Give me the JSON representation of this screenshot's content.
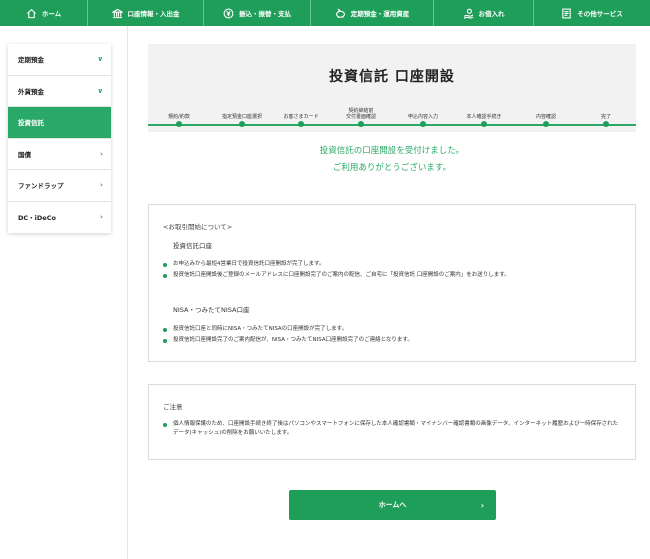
{
  "topnav": [
    {
      "label": "ホーム",
      "icon": "home-icon"
    },
    {
      "label": "口座情報・入出金",
      "icon": "bank-icon"
    },
    {
      "label": "振込・振替・支払",
      "icon": "yen-coin-icon"
    },
    {
      "label": "定期預金・運用資産",
      "icon": "piggy-bank-icon"
    },
    {
      "label": "お借入れ",
      "icon": "hand-coin-icon"
    },
    {
      "label": "その他サービス",
      "icon": "document-list-icon"
    }
  ],
  "sidebar": {
    "items": [
      {
        "label": "定期預金",
        "chevron": "∨"
      },
      {
        "label": "外貨預金",
        "chevron": "∨"
      },
      {
        "label": "投資信託",
        "chevron": ""
      },
      {
        "label": "国債",
        "chevron": "›"
      },
      {
        "label": "ファンドラップ",
        "chevron": "›"
      },
      {
        "label": "DC・iDeCo",
        "chevron": "›"
      }
    ]
  },
  "header": {
    "title": "投資信託 口座開設",
    "steps": [
      "規約/約款",
      "指定預金口座選択",
      "お客さまカード",
      "契約締結前\n交付書面確認",
      "申込内容入力",
      "本人確認手続き",
      "内容確認",
      "完了"
    ]
  },
  "complete": {
    "line1": "投資信託の口座開設を受付けました。",
    "line2": "ご利用ありがとうございます。"
  },
  "info": {
    "heading": "<お取引開始について>",
    "section1_title": "投資信託口座",
    "section1_bullets": [
      "お申込みから最短4営業日で投資信託口座開設が完了します。",
      "投資信託口座開設後ご登録のメールアドレスに口座開設完了のご案内の配信、ご自宅に「投資信託 口座開設のご案内」をお送りします。"
    ],
    "section2_title": "NISA・つみたてNISA口座",
    "section2_bullets": [
      "投資信託口座と同時にNISA・つみたてNISAの口座開設が完了します。",
      "投資信託口座開設完了のご案内配信が、NISA・つみたてNISA口座開設完了のご連絡となります。"
    ]
  },
  "notice": {
    "heading": "ご注意",
    "bullets": [
      "個人情報保護のため、口座開設手続き終了後はパソコンやスマートフォンに保存した本人確認書類・マイナンバー確認書類の画像データ、インターネット履歴および一時保存されたデータ(キャッシュ)の削除をお願いいたします。"
    ]
  },
  "home_button": {
    "label": "ホームへ",
    "arrow": "›"
  },
  "colors": {
    "brand_green": "#1f9e59",
    "accent_green": "#2aa867"
  }
}
